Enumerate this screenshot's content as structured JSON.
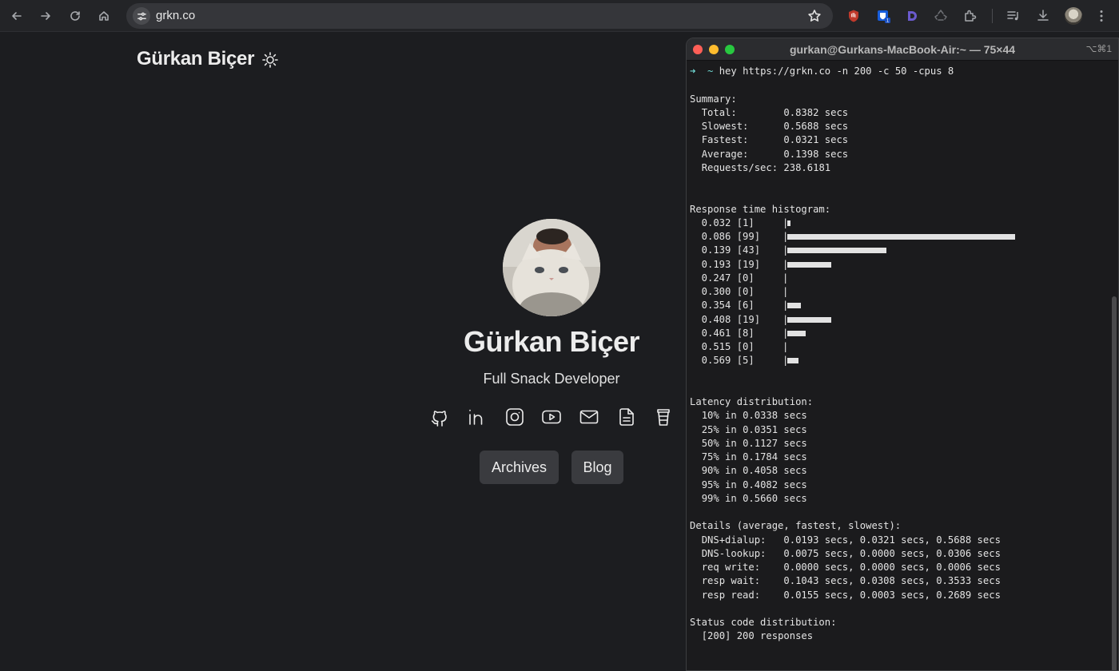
{
  "browser": {
    "url": "grkn.co",
    "extensions": [
      "ublock-icon",
      "bitwarden-icon",
      "dashlane-icon",
      "recycle-icon",
      "puzzle-icon",
      "media-icon",
      "download-icon",
      "profile-avatar",
      "menu-icon"
    ],
    "bitwarden_badge": "1",
    "colors": {
      "ublock": "#c0392b",
      "bitwarden": "#175ddc",
      "dashlane": "#6a5acd"
    }
  },
  "site": {
    "title": "Gürkan Biçer",
    "hero_name": "Gürkan Biçer",
    "tagline": "Full Snack Developer",
    "socials": [
      "github-icon",
      "linkedin-icon",
      "instagram-icon",
      "youtube-icon",
      "mail-icon",
      "resume-icon",
      "coffee-icon"
    ],
    "nav": [
      "Archives",
      "Blog"
    ]
  },
  "terminal": {
    "title": "gurkan@Gurkans-MacBook-Air:~ — 75×44",
    "shortcut": "⌥⌘1",
    "prompt_symbol": "➜",
    "prompt_dir": "~",
    "command": "hey https://grkn.co -n 200 -c 50 -cpus 8",
    "summary_header": "Summary:",
    "summary": [
      {
        "label": "Total:",
        "value": "0.8382 secs"
      },
      {
        "label": "Slowest:",
        "value": "0.5688 secs"
      },
      {
        "label": "Fastest:",
        "value": "0.0321 secs"
      },
      {
        "label": "Average:",
        "value": "0.1398 secs"
      },
      {
        "label": "Requests/sec:",
        "value": "238.6181"
      }
    ],
    "histogram_header": "Response time histogram:",
    "histogram": [
      {
        "bucket": "0.032",
        "count": 1
      },
      {
        "bucket": "0.086",
        "count": 99
      },
      {
        "bucket": "0.139",
        "count": 43
      },
      {
        "bucket": "0.193",
        "count": 19
      },
      {
        "bucket": "0.247",
        "count": 0
      },
      {
        "bucket": "0.300",
        "count": 0
      },
      {
        "bucket": "0.354",
        "count": 6
      },
      {
        "bucket": "0.408",
        "count": 19
      },
      {
        "bucket": "0.461",
        "count": 8
      },
      {
        "bucket": "0.515",
        "count": 0
      },
      {
        "bucket": "0.569",
        "count": 5
      }
    ],
    "latency_header": "Latency distribution:",
    "latency": [
      {
        "pct": "10%",
        "value": "0.0338 secs"
      },
      {
        "pct": "25%",
        "value": "0.0351 secs"
      },
      {
        "pct": "50%",
        "value": "0.1127 secs"
      },
      {
        "pct": "75%",
        "value": "0.1784 secs"
      },
      {
        "pct": "90%",
        "value": "0.4058 secs"
      },
      {
        "pct": "95%",
        "value": "0.4082 secs"
      },
      {
        "pct": "99%",
        "value": "0.5660 secs"
      }
    ],
    "details_header": "Details (average, fastest, slowest):",
    "details": [
      {
        "label": "DNS+dialup:",
        "value": "0.0193 secs, 0.0321 secs, 0.5688 secs"
      },
      {
        "label": "DNS-lookup:",
        "value": "0.0075 secs, 0.0000 secs, 0.0306 secs"
      },
      {
        "label": "req write:",
        "value": "0.0000 secs, 0.0000 secs, 0.0006 secs"
      },
      {
        "label": "resp wait:",
        "value": "0.1043 secs, 0.0308 secs, 0.3533 secs"
      },
      {
        "label": "resp read:",
        "value": "0.0155 secs, 0.0003 secs, 0.2689 secs"
      }
    ],
    "status_header": "Status code distribution:",
    "status": [
      "[200] 200 responses"
    ]
  }
}
